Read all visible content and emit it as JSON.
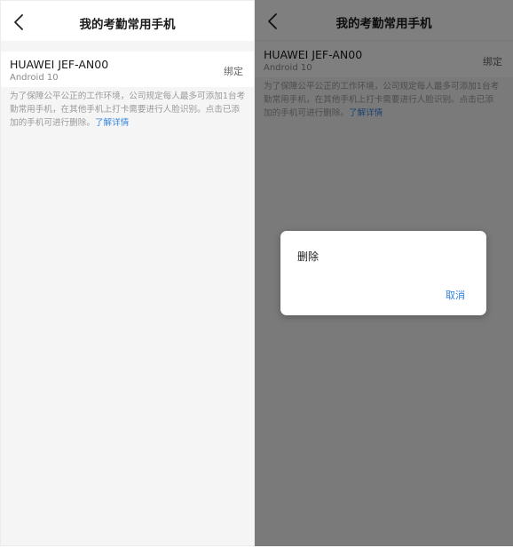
{
  "screen": {
    "title": "我的考勤常用手机",
    "device": {
      "name": "HUAWEI JEF-AN00",
      "os": "Android 10",
      "action_label": "绑定"
    },
    "notice": {
      "text": "为了保障公平公正的工作环境，公司规定每人最多可添加1台考勤常用手机，在其他手机上打卡需要进行人脸识别。点击已添加的手机可进行删除。",
      "link_label": "了解详情"
    }
  },
  "dialog": {
    "option_label": "删除",
    "cancel_label": "取消"
  },
  "icons": {
    "back": "chevron-left-icon"
  },
  "colors": {
    "link": "#3a86e0",
    "overlay": "rgba(0,0,0,0.5)"
  }
}
